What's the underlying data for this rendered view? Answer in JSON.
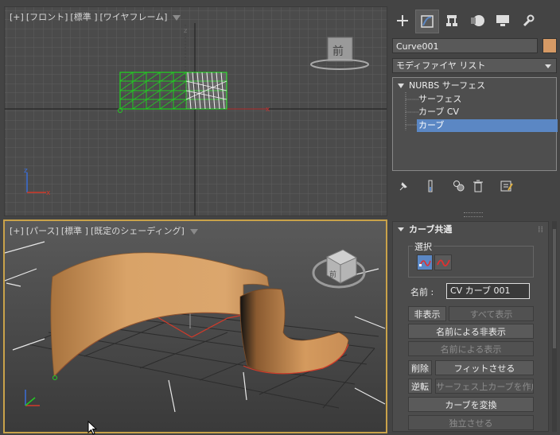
{
  "viewport_front": {
    "label_plus": "[+]",
    "label_view": "[フロント]",
    "label_std": "[標準 ]",
    "label_mode": "[ワイヤフレーム]",
    "nav_cube_label": "前",
    "axis_z": "z",
    "axis_x": "x"
  },
  "viewport_persp": {
    "label_plus": "[+]",
    "label_view": "[パース]",
    "label_std": "[標準 ]",
    "label_mode": "[既定のシェーディング]",
    "axis_z": "z",
    "axis_x": "x",
    "axis_y": "y",
    "nav_cube_label": "前"
  },
  "command_panel": {
    "tabs": [
      "create-tab",
      "modify-tab",
      "hierarchy-tab",
      "motion-tab",
      "display-tab",
      "utilities-tab"
    ],
    "object_name": "Curve001",
    "object_color": "#d69a65",
    "modifier_list": "モディファイヤ リスト",
    "stack": [
      {
        "label": "NURBS サーフェス",
        "selected": false
      },
      {
        "label": "サーフェス",
        "selected": false
      },
      {
        "label": "カーブ CV",
        "selected": false
      },
      {
        "label": "カーブ",
        "selected": true
      }
    ]
  },
  "rollout": {
    "title": "カーブ共通",
    "selection_group": "選択",
    "name_label": "名前 :",
    "name_value": "CV カーブ 001",
    "hide": "非表示",
    "unhide_all": "すべて表示",
    "hide_by_name": "名前による非表示",
    "unhide_by_name": "名前による表示",
    "delete": "削除",
    "make_fit": "フィットさせる",
    "reverse": "逆転",
    "make_cos": "サーフェス上カーブを作成",
    "convert_curve": "カーブを変換",
    "make_independent": "独立させる"
  },
  "colors": {
    "accent_blue": "#5b87c4",
    "viewport_active_border": "#c9a24a",
    "surface_orange": "#d69a65",
    "selection_green": "#22cc22",
    "curve_red": "#d23a2a"
  }
}
